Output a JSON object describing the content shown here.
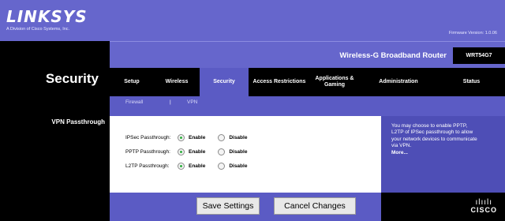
{
  "brand": {
    "logo": "LINKSYS",
    "tagline": "A Division of Cisco Systems, Inc.",
    "firmware": "Firmware Version: 1.0.06"
  },
  "section_title": "Security",
  "product": {
    "name": "Wireless-G Broadband Router",
    "model": "WRT54G7"
  },
  "tabs": [
    {
      "label": "Setup",
      "active": false
    },
    {
      "label": "Wireless",
      "active": false
    },
    {
      "label": "Security",
      "active": true
    },
    {
      "label": "Access Restrictions",
      "active": false
    },
    {
      "label": "Applications & Gaming",
      "active": false
    },
    {
      "label": "Administration",
      "active": false
    },
    {
      "label": "Status",
      "active": false
    }
  ],
  "subtabs": {
    "firewall": "Firewall",
    "separator": "|",
    "vpn": "VPN"
  },
  "vpn": {
    "title": "VPN Passthrough",
    "rows": [
      {
        "label": "IPSec Passthrough:",
        "enable": "Enable",
        "disable": "Disable",
        "selected": "enable"
      },
      {
        "label": "PPTP Passthrough:",
        "enable": "Enable",
        "disable": "Disable",
        "selected": "enable"
      },
      {
        "label": "L2TP Passthrough:",
        "enable": "Enable",
        "disable": "Disable",
        "selected": "enable"
      }
    ]
  },
  "help": {
    "text": "You may choose to enable PPTP, L2TP of IPSec passthrough to allow your network devices to communicate via VPN.",
    "more": "More..."
  },
  "footer": {
    "save": "Save Settings",
    "cancel": "Cancel Changes",
    "cisco_bars": "ılıılı",
    "cisco": "CISCO"
  },
  "colors": {
    "banner": "#6666cc",
    "panel": "#5b5bc4",
    "dark": "#000000",
    "radio_on": "#2fae3f"
  }
}
